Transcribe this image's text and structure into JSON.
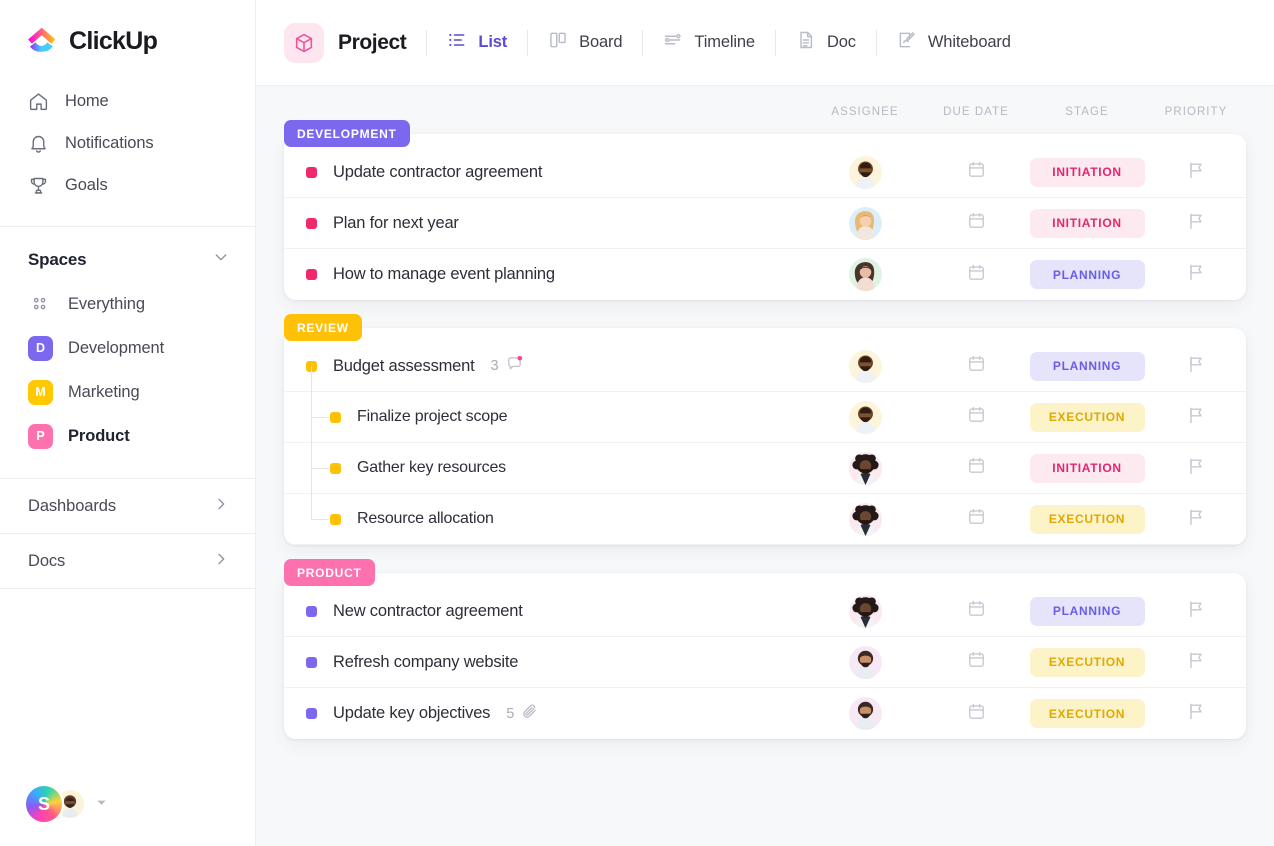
{
  "brand": {
    "name": "ClickUp"
  },
  "sidebar": {
    "nav": [
      {
        "label": "Home",
        "icon": "home-icon"
      },
      {
        "label": "Notifications",
        "icon": "bell-icon"
      },
      {
        "label": "Goals",
        "icon": "trophy-icon"
      }
    ],
    "spaces": {
      "title": "Spaces",
      "chevron": "chevron-down-icon",
      "items": [
        {
          "label": "Everything",
          "icon": "grid-icon",
          "badge": "",
          "color": "",
          "active": false
        },
        {
          "label": "Development",
          "icon": "space-badge",
          "badge": "D",
          "color": "#7b68ee",
          "active": false
        },
        {
          "label": "Marketing",
          "icon": "space-badge",
          "badge": "M",
          "color": "#ffc800",
          "active": false
        },
        {
          "label": "Product",
          "icon": "space-badge",
          "badge": "P",
          "color": "#fd71af",
          "active": true
        }
      ]
    },
    "bottom_nav": [
      {
        "label": "Dashboards",
        "icon": "chevron-right-icon"
      },
      {
        "label": "Docs",
        "icon": "chevron-right-icon"
      }
    ],
    "user_dock": {
      "initial": "S",
      "caret": "caret-down-icon"
    }
  },
  "topbar": {
    "project_icon": "cube-icon",
    "project_title": "Project",
    "views": [
      {
        "label": "List",
        "icon": "list-icon",
        "active": true
      },
      {
        "label": "Board",
        "icon": "board-icon",
        "active": false
      },
      {
        "label": "Timeline",
        "icon": "timeline-icon",
        "active": false
      },
      {
        "label": "Doc",
        "icon": "doc-icon",
        "active": false
      },
      {
        "label": "Whiteboard",
        "icon": "whiteboard-icon",
        "active": false
      }
    ]
  },
  "columns": {
    "assignee": "ASSIGNEE",
    "due_date": "DUE DATE",
    "stage": "STAGE",
    "priority": "PRIORITY"
  },
  "stage_colors": {
    "INITIATION": {
      "bg": "#fde9f0",
      "fg": "#e5266d"
    },
    "PLANNING": {
      "bg": "#e5e4fb",
      "fg": "#6b5ce7"
    },
    "EXECUTION": {
      "bg": "#fdf3c9",
      "fg": "#e0a800"
    }
  },
  "groups": [
    {
      "tag": "DEVELOPMENT",
      "tag_color": "#7b68ee",
      "bullet_color": "#ef2a6b",
      "tasks": [
        {
          "name": "Update contractor agreement",
          "sub": false,
          "stage": "INITIATION",
          "assignee": "man-beard",
          "due_date": "",
          "priority_flag": "flag-icon",
          "comments": "",
          "attachments": ""
        },
        {
          "name": "Plan for next year",
          "sub": false,
          "stage": "INITIATION",
          "assignee": "woman-blonde",
          "due_date": "",
          "priority_flag": "flag-icon",
          "comments": "",
          "attachments": ""
        },
        {
          "name": "How to manage event planning",
          "sub": false,
          "stage": "PLANNING",
          "assignee": "woman-dark",
          "due_date": "",
          "priority_flag": "flag-icon",
          "comments": "",
          "attachments": ""
        }
      ]
    },
    {
      "tag": "REVIEW",
      "tag_color": "#ffc107",
      "bullet_color": "#ffc107",
      "tasks": [
        {
          "name": "Budget assessment",
          "sub": false,
          "stage": "PLANNING",
          "assignee": "man-beard",
          "due_date": "",
          "priority_flag": "flag-icon",
          "comments": "3",
          "attachments": ""
        },
        {
          "name": "Finalize project scope",
          "sub": true,
          "stage": "EXECUTION",
          "assignee": "man-beard",
          "due_date": "",
          "priority_flag": "flag-icon",
          "comments": "",
          "attachments": ""
        },
        {
          "name": "Gather key resources",
          "sub": true,
          "stage": "INITIATION",
          "assignee": "man-afro",
          "due_date": "",
          "priority_flag": "flag-icon",
          "comments": "",
          "attachments": ""
        },
        {
          "name": "Resource allocation",
          "sub": true,
          "stage": "EXECUTION",
          "assignee": "man-afro",
          "due_date": "",
          "priority_flag": "flag-icon",
          "comments": "",
          "attachments": ""
        }
      ]
    },
    {
      "tag": "PRODUCT",
      "tag_color": "#fd71af",
      "bullet_color": "#7b68ee",
      "tasks": [
        {
          "name": "New contractor agreement",
          "sub": false,
          "stage": "PLANNING",
          "assignee": "man-afro",
          "due_date": "",
          "priority_flag": "flag-icon",
          "comments": "",
          "attachments": ""
        },
        {
          "name": "Refresh company website",
          "sub": false,
          "stage": "EXECUTION",
          "assignee": "man-shorthair",
          "due_date": "",
          "priority_flag": "flag-icon",
          "comments": "",
          "attachments": ""
        },
        {
          "name": "Update key objectives",
          "sub": false,
          "stage": "EXECUTION",
          "assignee": "man-shorthair",
          "due_date": "",
          "priority_flag": "flag-icon",
          "comments": "",
          "attachments": "5"
        }
      ]
    }
  ]
}
